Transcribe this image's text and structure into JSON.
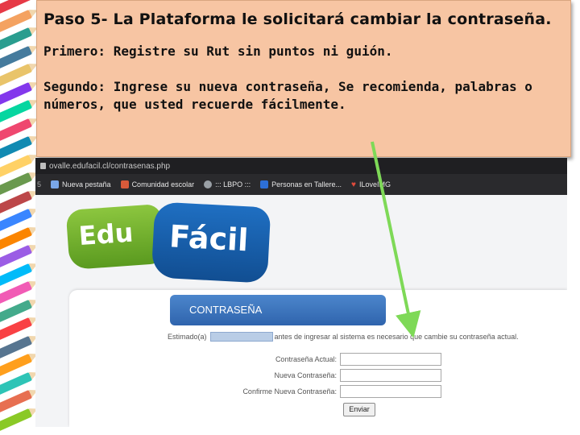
{
  "instructions": {
    "title": "Paso 5- La Plataforma le solicitará cambiar la contraseña.",
    "step1": "Primero: Registre su Rut sin puntos ni guión.",
    "step2_line1": "Segundo: Ingrese su nueva contraseña, Se recomienda, palabras o",
    "step2_line2": "números, que usted recuerde fácilmente."
  },
  "browser": {
    "url": "ovalle.edufacil.cl/contrasenas.php",
    "bookmarks": [
      {
        "label": "Nueva pestaña",
        "icon": "page-icon",
        "color": "#7aa7e8"
      },
      {
        "label": "Comunidad escolar",
        "icon": "book-icon",
        "color": "#d85a3a"
      },
      {
        "label": "::: LBPO :::",
        "icon": "globe-icon",
        "color": "#9aa0a6"
      },
      {
        "label": "Personas en Tallere...",
        "icon": "bluejeans-icon",
        "color": "#2d6fd6"
      },
      {
        "label": "ILoveIMG",
        "icon": "heart-icon",
        "color": "#e04b3c"
      }
    ]
  },
  "site": {
    "logo_edu": "Edu",
    "logo_facil": "Fácil",
    "header": "CONTRASEÑA",
    "estimado_prefix": "Estimado(a)",
    "estimado_suffix": "antes de ingresar al sistema es necesario que cambie su contraseña actual.",
    "fields": {
      "current": "Contraseña Actual:",
      "new": "Nueva Contraseña:",
      "confirm": "Confirme Nueva Contraseña:"
    },
    "submit": "Enviar"
  },
  "colors": {
    "instruction_bg": "#f7c5a3",
    "arrow": "#7ed957",
    "logo_green": "#8cc63f",
    "logo_blue": "#1f6fc2"
  }
}
